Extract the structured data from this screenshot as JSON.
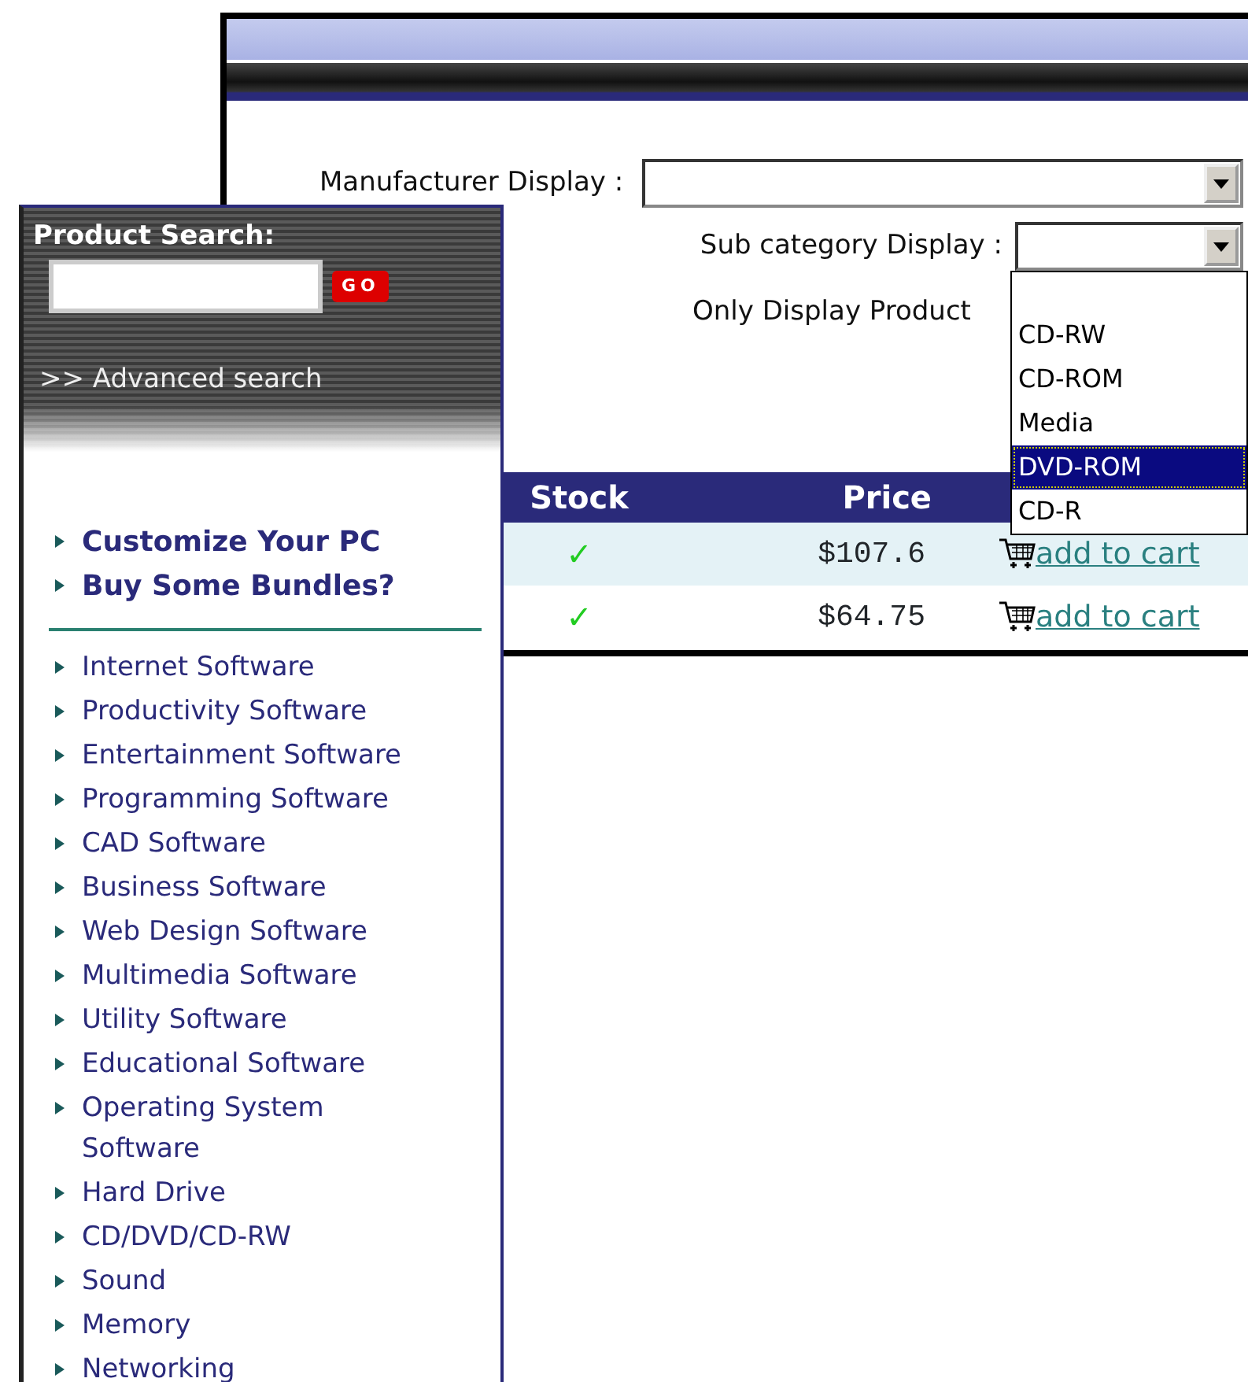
{
  "product_window": {
    "form": {
      "manufacturer_label": "Manufacturer Display :",
      "subcategory_label": "Sub category Display :",
      "only_display_label": "Only Display Product",
      "subcategory_options": [
        {
          "label": "CD-RW",
          "selected": false
        },
        {
          "label": "CD-ROM",
          "selected": false
        },
        {
          "label": "Media",
          "selected": false
        },
        {
          "label": "DVD-ROM",
          "selected": true
        },
        {
          "label": "CD-R",
          "selected": false
        }
      ]
    },
    "table": {
      "columns": [
        "Stock",
        "Price"
      ],
      "rows": [
        {
          "stock": "✓",
          "price": "$107.6",
          "action": "add to cart"
        },
        {
          "stock": "✓",
          "price": "$64.75",
          "action": "add to cart"
        }
      ]
    }
  },
  "sidebar": {
    "search_title": "Product Search:",
    "go_button": "GO",
    "advanced_link": ">> Advanced search",
    "featured_links": [
      "Customize Your PC",
      "Buy Some Bundles?"
    ],
    "categories": [
      "Internet Software",
      "Productivity Software",
      "Entertainment Software",
      "Programming Software",
      "CAD Software",
      "Business Software",
      "Web Design Software",
      "Multimedia Software",
      "Utility Software",
      "Educational Software",
      "Operating System Software",
      "Hard Drive",
      "CD/DVD/CD-RW",
      "Sound",
      "Memory",
      "Networking"
    ]
  }
}
